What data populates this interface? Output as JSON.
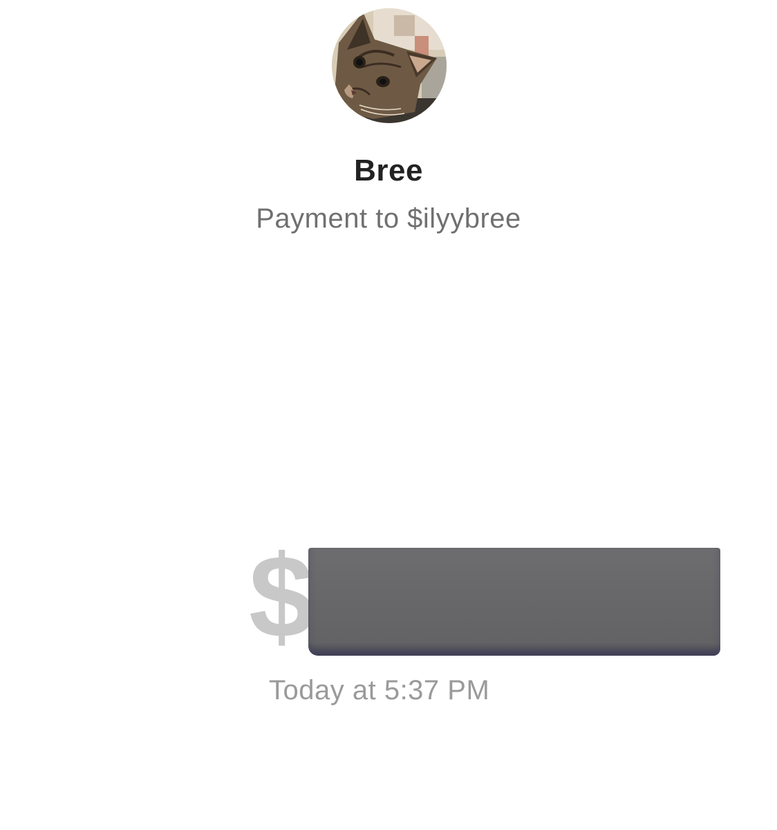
{
  "recipient": {
    "name": "Bree",
    "subtitle": "Payment to $ilyybree",
    "avatar_icon": "cat-photo-avatar"
  },
  "payment": {
    "currency_symbol": "$",
    "amount_redacted": true,
    "timestamp": "Today at 5:37 PM"
  },
  "colors": {
    "name_text": "#222222",
    "subtitle_text": "#707070",
    "currency_symbol": "#c8c8c8",
    "redaction_block": "#666668",
    "timestamp_text": "#9a9a9a"
  }
}
